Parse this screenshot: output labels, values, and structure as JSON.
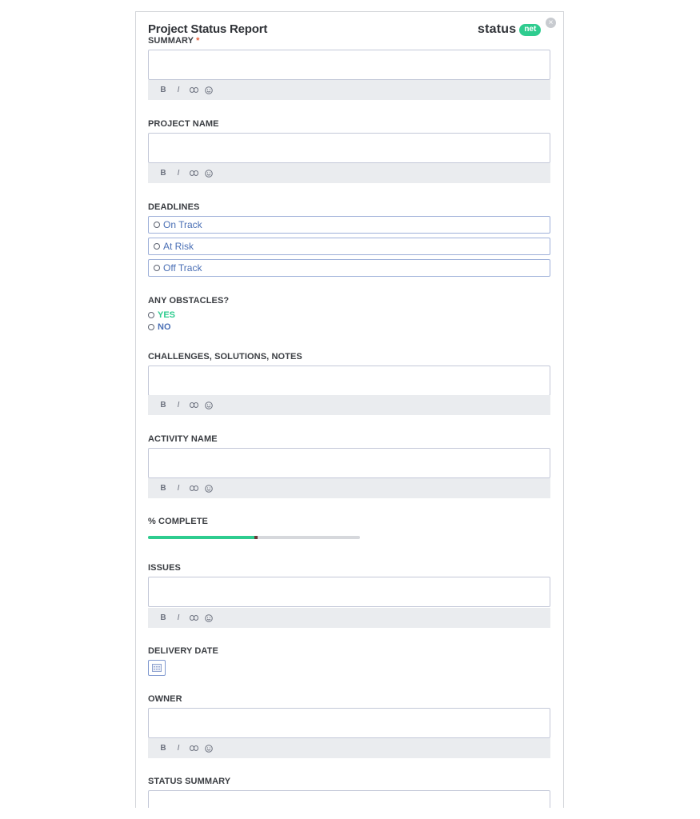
{
  "form": {
    "title": "Project Status Report",
    "brand": {
      "word": "status",
      "pill": "net"
    },
    "close_icon": "close-icon"
  },
  "fields": {
    "summary": {
      "label": "SUMMARY",
      "required_mark": "*"
    },
    "project_name": {
      "label": "PROJECT NAME"
    },
    "deadlines": {
      "label": "DEADLINES",
      "options": [
        "On Track",
        "At Risk",
        "Off Track"
      ]
    },
    "obstacles": {
      "label": "ANY OBSTACLES?",
      "options": [
        "YES",
        "NO"
      ],
      "colors": {
        "yes": "#2ecc8f",
        "no": "#4a6fb5"
      }
    },
    "challenges": {
      "label": "CHALLENGES, SOLUTIONS, NOTES"
    },
    "activity_name": {
      "label": "ACTIVITY NAME"
    },
    "percent_complete": {
      "label": "% COMPLETE",
      "value_fraction": 0.51
    },
    "issues": {
      "label": "ISSUES"
    },
    "delivery_date": {
      "label": "DELIVERY DATE",
      "icon": "calendar-icon"
    },
    "owner": {
      "label": "OWNER"
    },
    "status_summary": {
      "label": "STATUS SUMMARY"
    }
  },
  "toolbar": {
    "bold": "B",
    "italic": "I",
    "icons": [
      "bold-icon",
      "italic-icon",
      "link-icon",
      "emoji-icon"
    ]
  },
  "colors": {
    "accent_green": "#2ecc8f",
    "option_blue": "#4a6fb5",
    "required_red": "#e8603c"
  }
}
